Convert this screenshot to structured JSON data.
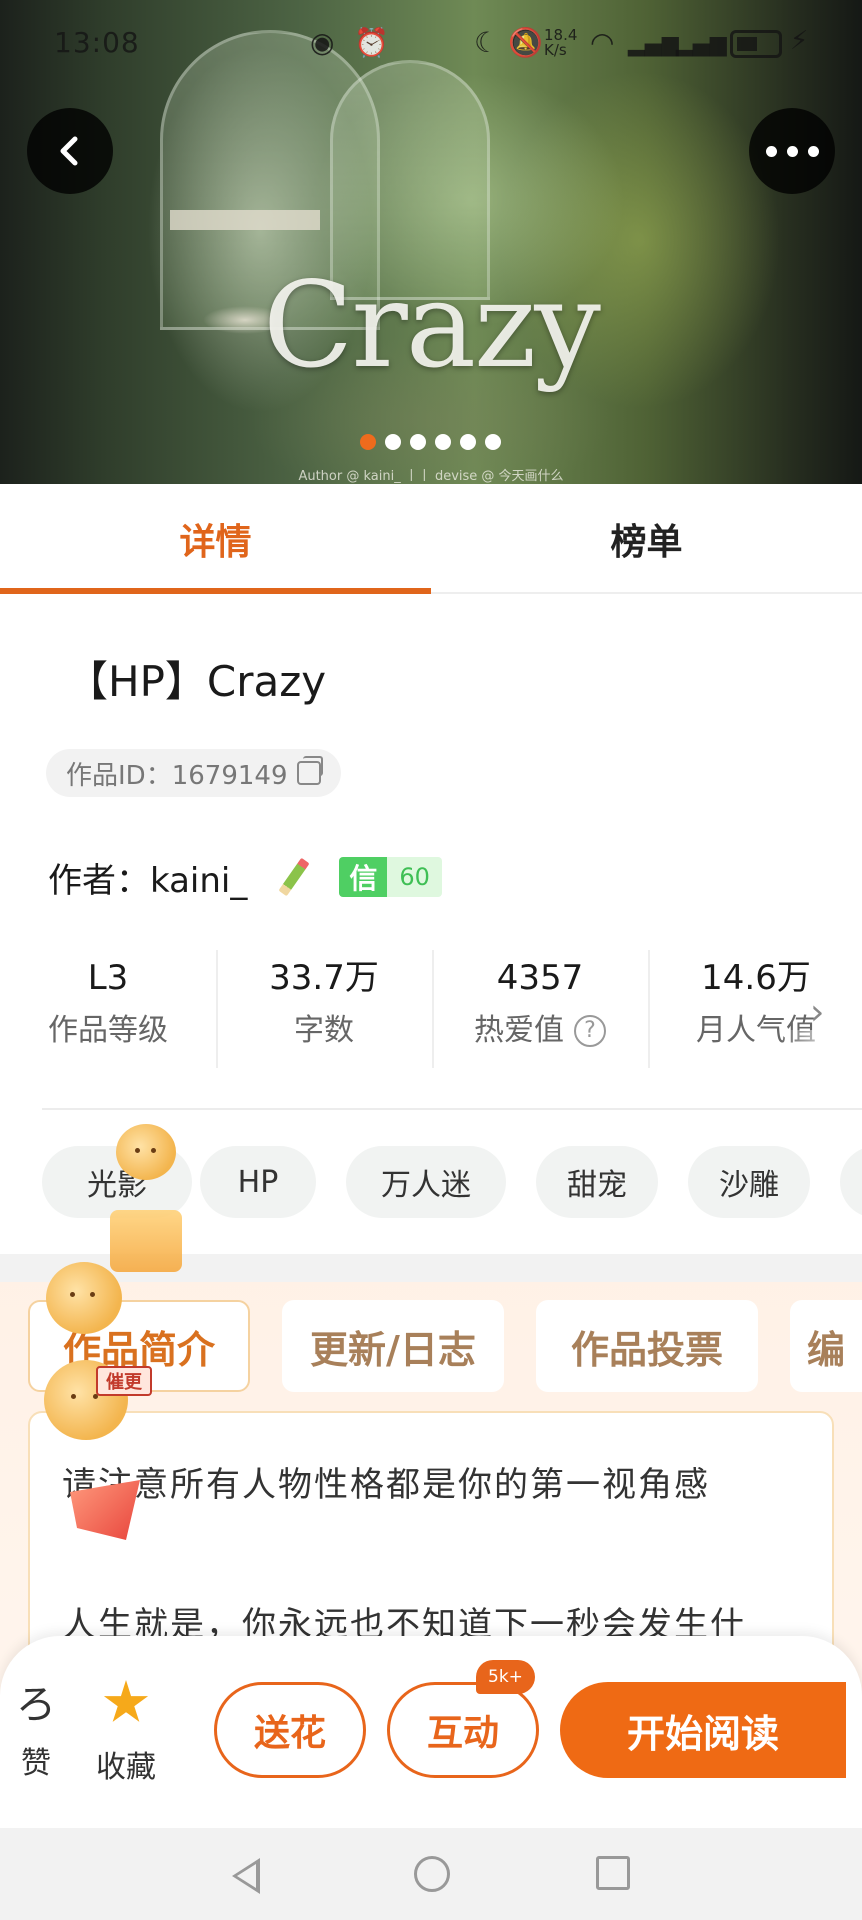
{
  "status_bar": {
    "time": "13:08",
    "net_speed": "18.4 K/s"
  },
  "hero": {
    "title": "Crazy",
    "credit": "Author @ kaini_ 丨丨 devise @ 今天画什么",
    "slide_count": 6,
    "active_slide": 1
  },
  "tabs": [
    {
      "label": "详情",
      "active": true
    },
    {
      "label": "榜单",
      "active": false
    }
  ],
  "work": {
    "title": "【HP】Crazy",
    "id_label": "作品ID：1679149",
    "author": "作者：kaini_",
    "badge_label": "信",
    "badge_value": "60"
  },
  "stats": [
    {
      "value": "L3",
      "label": "作品等级"
    },
    {
      "value": "33.7万",
      "label": "字数"
    },
    {
      "value": "4357",
      "label": "热爱值"
    },
    {
      "value": "14.6万",
      "label": "月人气值"
    }
  ],
  "tags": [
    "光影",
    "HP",
    "万人迷",
    "甜宠",
    "沙雕"
  ],
  "sub_tabs": [
    {
      "label": "作品简介",
      "active": true
    },
    {
      "label": "更新/日志",
      "active": false
    },
    {
      "label": "作品投票",
      "active": false
    },
    {
      "label": "编",
      "active": false
    }
  ],
  "mascot_sign": "催更",
  "intro": {
    "line1": "请注意所有人物性格都是你的第一视角感",
    "line2": "人生就是，你永远也不知道下一秒会发生什"
  },
  "actions": {
    "like_label": "赞",
    "favorite_label": "收藏",
    "flower_label": "送花",
    "interact_label": "互动",
    "interact_count": "5k+",
    "read_label": "开始阅读"
  },
  "colors": {
    "accent": "#e8651b",
    "read_button": "#ef6a14",
    "badge_green": "#4fcf63"
  },
  "icons": {
    "back": "chevron-left-icon",
    "more": "more-dots-icon",
    "copy": "copy-icon",
    "pencil": "pencil-icon",
    "help": "question-circle-icon",
    "star": "star-icon"
  }
}
